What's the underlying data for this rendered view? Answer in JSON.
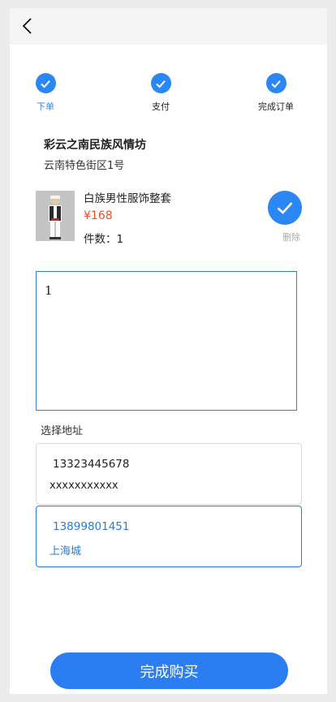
{
  "steps": [
    {
      "label": "下单",
      "active": true
    },
    {
      "label": "支付",
      "active": false
    },
    {
      "label": "完成订单",
      "active": false
    }
  ],
  "shop": {
    "name": "彩云之南民族风情坊",
    "address": "云南特色街区1号"
  },
  "product": {
    "name": "白族男性服饰整套",
    "price": "¥168",
    "quantity": "件数：1",
    "delete_label": "删除"
  },
  "note": {
    "value": "1"
  },
  "address_section": {
    "title": "选择地址",
    "options": [
      {
        "phone": "13323445678",
        "address": "xxxxxxxxxxx",
        "selected": false
      },
      {
        "phone": "13899801451",
        "address": "上海城",
        "selected": true
      }
    ]
  },
  "buy_button": {
    "label": "完成购买"
  },
  "colors": {
    "accent": "#2b87f3",
    "price": "#e8502c",
    "delete": "#aaaaaa"
  }
}
